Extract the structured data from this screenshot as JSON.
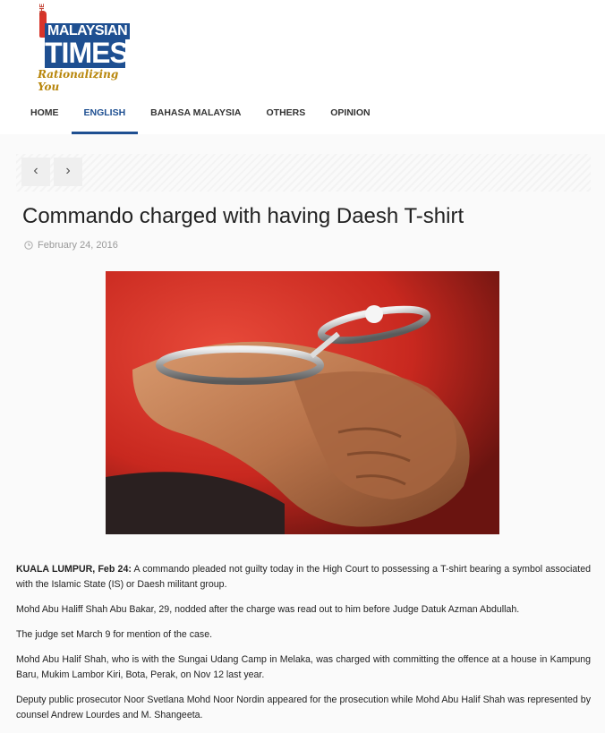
{
  "logo": {
    "the": "THE",
    "malaysian": "MALAYSIAN",
    "times": "TIMES",
    "tagline": "Rationalizing You"
  },
  "nav": [
    {
      "label": "HOME",
      "active": false
    },
    {
      "label": "ENGLISH",
      "active": true
    },
    {
      "label": "BAHASA MALAYSIA",
      "active": false
    },
    {
      "label": "OTHERS",
      "active": false
    },
    {
      "label": "OPINION",
      "active": false
    }
  ],
  "pager": {
    "prev": "‹",
    "next": "›"
  },
  "article": {
    "title": "Commando charged with having Daesh T-shirt",
    "date": "February 24, 2016",
    "dateline": "KUALA LUMPUR, Feb 24:",
    "lead": " A commando pleaded not guilty today in the High Court to possessing a T-shirt bearing a symbol associated with the Islamic State (IS) or Daesh militant group.",
    "paragraphs": [
      "Mohd Abu Haliff Shah Abu Bakar, 29, nodded after the charge was read out to him before Judge Datuk Azman Abdullah.",
      "The judge set March 9 for mention of the case.",
      "Mohd Abu Halif Shah, who is with the Sungai Udang Camp in Melaka, was charged with committing the offence at a house in Kampung Baru, Mukim Lambor Kiri, Bota, Perak, on Nov 12 last year.",
      "Deputy public prosecutor Noor Svetlana Mohd Noor Nordin appeared for the prosecution while Mohd Abu Halif Shah was represented by counsel Andrew Lourdes and M. Shangeeta."
    ]
  },
  "colors": {
    "brand": "#1e4f91",
    "accent": "#d8352a",
    "tagline": "#b8860b"
  }
}
